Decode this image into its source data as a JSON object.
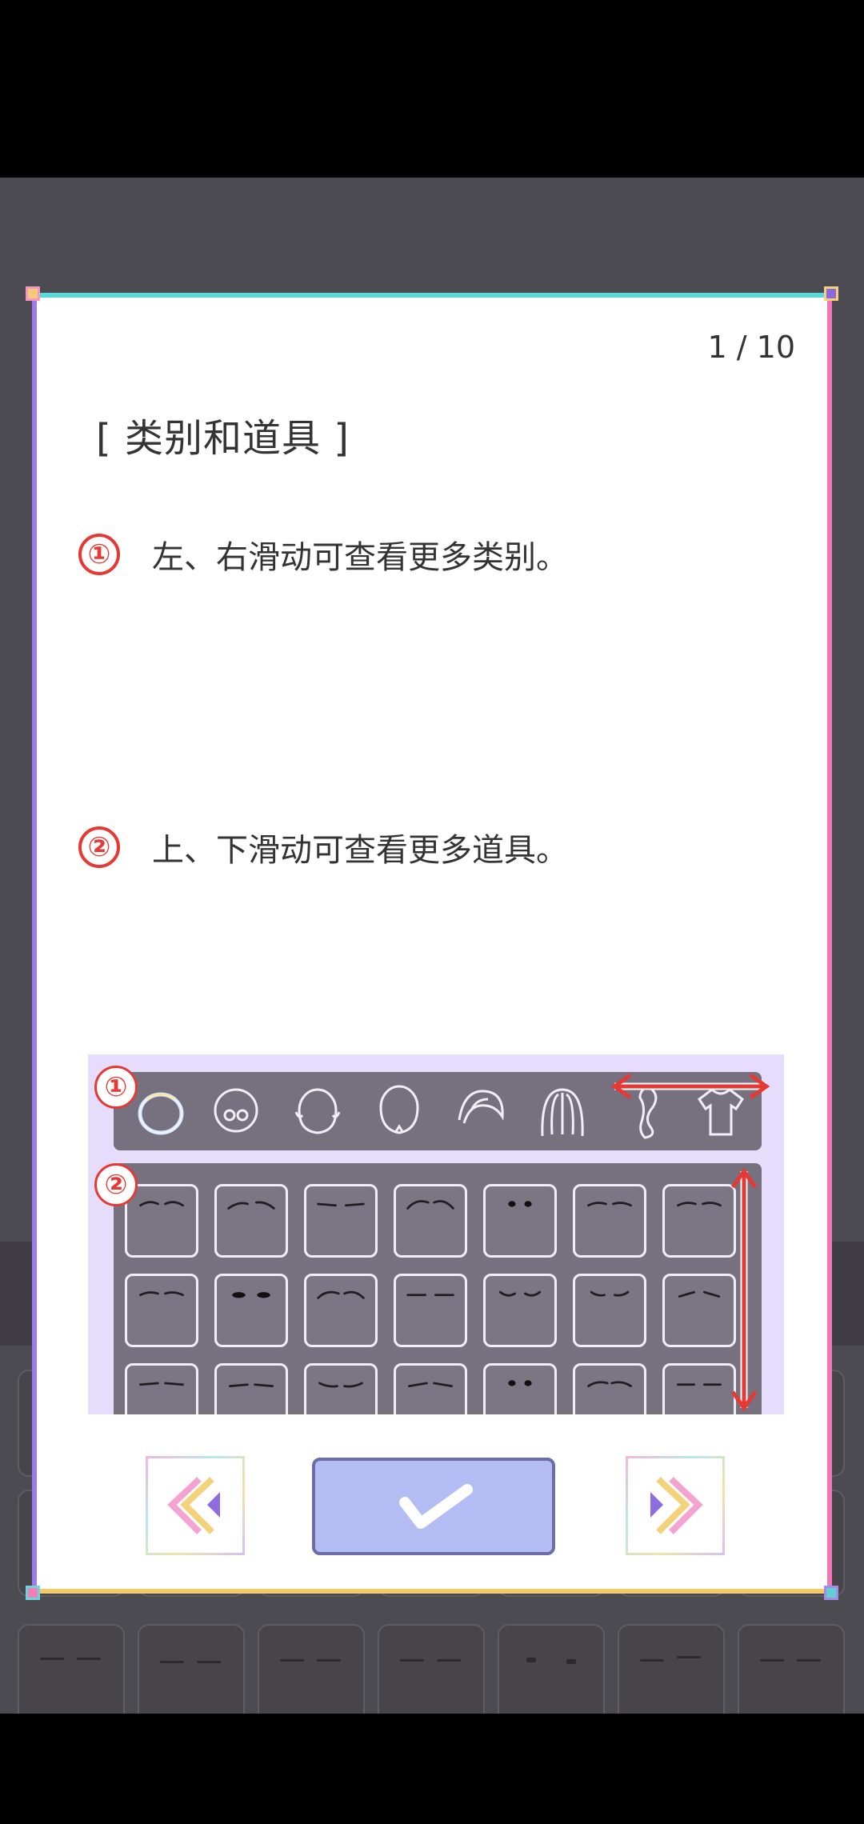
{
  "dialog": {
    "page_counter": "1 / 10",
    "title": "[ 类别和道具 ]",
    "steps": [
      {
        "number": "①",
        "text": "左、右滑动可查看更多类别。"
      },
      {
        "number": "②",
        "text": "上、下滑动可查看更多道具。"
      }
    ]
  },
  "illustration": {
    "markers": [
      "①",
      "②"
    ]
  },
  "buttons": {
    "prev_icon": "double-chevron-left-icon",
    "confirm_icon": "checkmark-icon",
    "next_icon": "double-chevron-right-icon"
  },
  "colors": {
    "accent_red": "#e53935",
    "confirm_bg": "#b3bdf4",
    "panel_bg": "#77717f",
    "illustration_bg": "#e5ddfb"
  }
}
